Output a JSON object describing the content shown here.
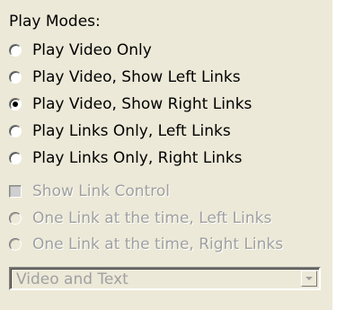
{
  "heading": "Play Modes:",
  "play_modes": [
    {
      "label": "Play Video Only",
      "selected": false
    },
    {
      "label": "Play Video, Show Left Links",
      "selected": false
    },
    {
      "label": "Play Video, Show Right Links",
      "selected": true
    },
    {
      "label": "Play Links Only, Left Links",
      "selected": false
    },
    {
      "label": "Play Links Only, Right Links",
      "selected": false
    }
  ],
  "show_link_control": {
    "label": "Show Link Control",
    "checked": false,
    "enabled": false
  },
  "link_modes": [
    {
      "label": "One Link at the time, Left Links",
      "enabled": false
    },
    {
      "label": "One Link at the time, Right Links",
      "enabled": false
    }
  ],
  "display_select": {
    "value": "Video and Text",
    "enabled": false
  }
}
